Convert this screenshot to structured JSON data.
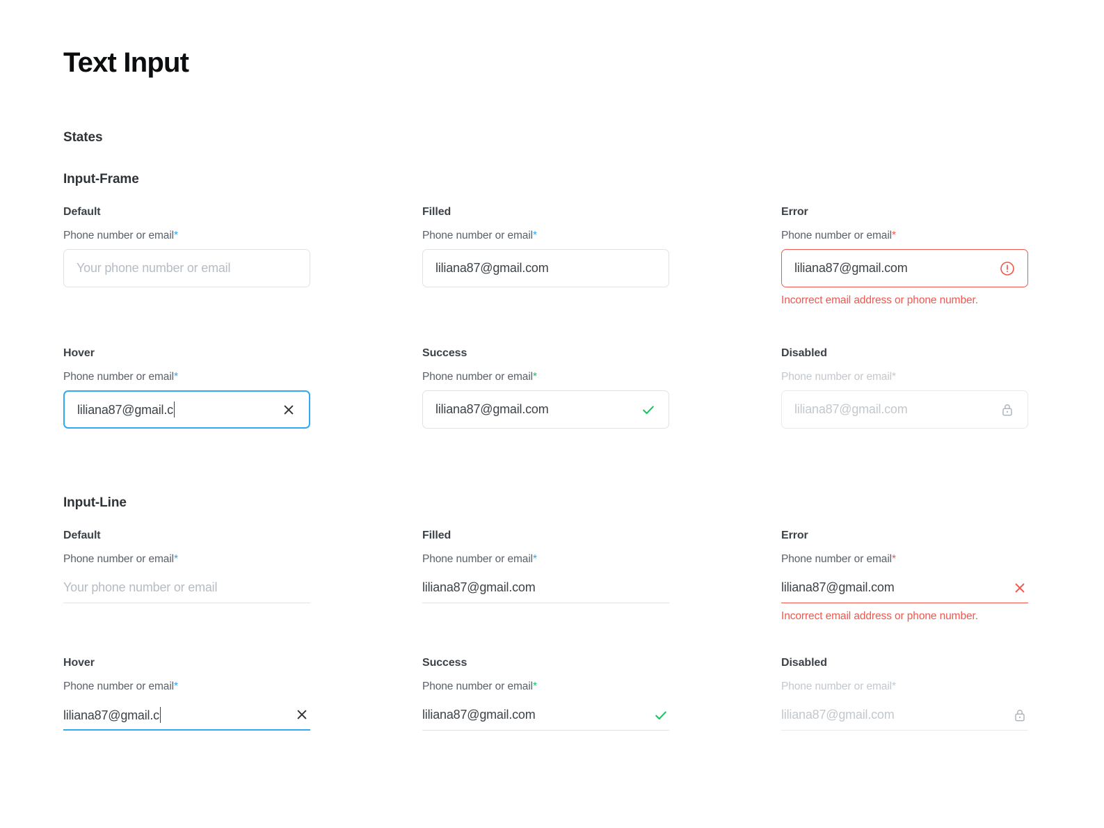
{
  "page": {
    "title": "Text Input",
    "sections": {
      "states": "States",
      "input_frame": "Input-Frame",
      "input_line": "Input-Line"
    }
  },
  "colors": {
    "accent_blue": "#30A9F2",
    "error_red": "#F2564D",
    "success_green": "#17C25F",
    "border_gray": "#DFE3E8",
    "text_dark": "#3C4247",
    "text_muted": "#5A6068",
    "text_disabled": "#C3C8CD"
  },
  "common": {
    "field_label": "Phone number or email",
    "required_marker": "*",
    "placeholder": "Your phone number or email",
    "email_value": "liliana87@gmail.com",
    "email_partial": "liliana87@gmail.c",
    "error_message": "Incorrect email address or phone number."
  },
  "input_frame": {
    "default": {
      "state_label": "Default",
      "value": "",
      "placeholder": "Your phone number or email",
      "icon": "none"
    },
    "filled": {
      "state_label": "Filled",
      "value": "liliana87@gmail.com",
      "icon": "none"
    },
    "error": {
      "state_label": "Error",
      "value": "liliana87@gmail.com",
      "icon": "error-circle-icon",
      "message": "Incorrect email address or phone number."
    },
    "hover": {
      "state_label": "Hover",
      "value": "liliana87@gmail.c",
      "icon": "clear-x-icon"
    },
    "success": {
      "state_label": "Success",
      "value": "liliana87@gmail.com",
      "icon": "check-icon"
    },
    "disabled": {
      "state_label": "Disabled",
      "value": "liliana87@gmail.com",
      "icon": "lock-icon"
    }
  },
  "input_line": {
    "default": {
      "state_label": "Default",
      "value": "",
      "placeholder": "Your phone number or email",
      "icon": "none"
    },
    "filled": {
      "state_label": "Filled",
      "value": "liliana87@gmail.com",
      "icon": "none"
    },
    "error": {
      "state_label": "Error",
      "value": "liliana87@gmail.com",
      "icon": "error-x-icon",
      "message": "Incorrect email address or phone number."
    },
    "hover": {
      "state_label": "Hover",
      "value": "liliana87@gmail.c",
      "icon": "clear-x-icon"
    },
    "success": {
      "state_label": "Success",
      "value": "liliana87@gmail.com",
      "icon": "check-icon"
    },
    "disabled": {
      "state_label": "Disabled",
      "value": "liliana87@gmail.com",
      "icon": "lock-icon"
    }
  }
}
